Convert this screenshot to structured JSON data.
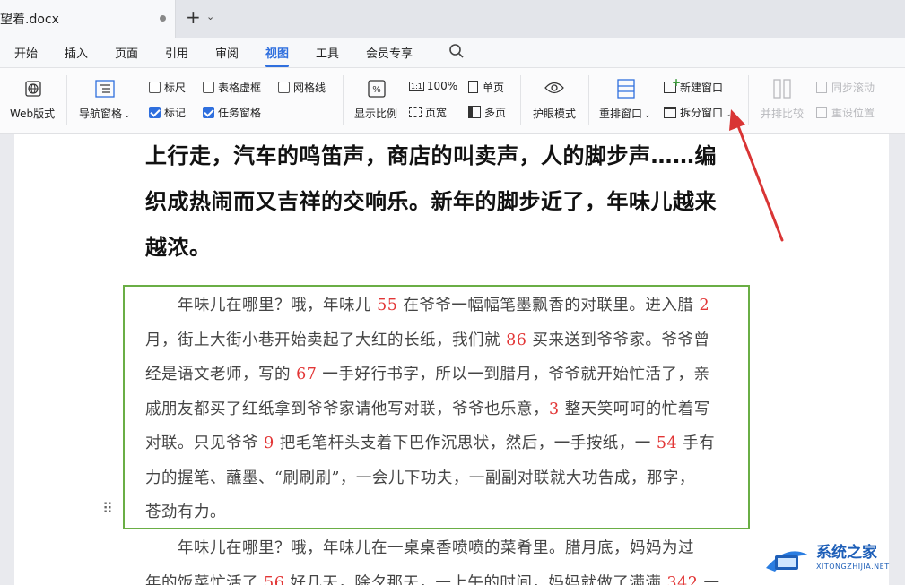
{
  "tab": {
    "title": "望着.docx",
    "new_tab_label": "+",
    "new_tab_dropdown": "⌄"
  },
  "menu": {
    "items": [
      "开始",
      "插入",
      "页面",
      "引用",
      "审阅",
      "视图",
      "工具",
      "会员专享"
    ],
    "active": "视图",
    "search_icon": "search-icon"
  },
  "ribbon": {
    "web_layout": "Web版式",
    "nav_pane": "导航窗格",
    "ruler": "标尺",
    "table_gridlines": "表格虚框",
    "gridlines": "网格线",
    "markers": "标记",
    "task_pane": "任务窗格",
    "zoom": "显示比例",
    "zoom_100": "100%",
    "page_width": "页宽",
    "single_page": "单页",
    "multi_page": "多页",
    "eye_mode": "护眼模式",
    "arrange": "重排窗口",
    "new_window": "新建窗口",
    "split_window": "拆分窗口",
    "side_by_side": "并排比较",
    "sync_scroll": "同步滚动",
    "reset_position": "重设位置",
    "checkboxes": {
      "ruler": false,
      "table_gridlines": false,
      "gridlines": false,
      "markers": true,
      "task_pane": true
    }
  },
  "document": {
    "heading_lines": [
      "上行走，汽车的鸣笛声，商店的叫卖声，人的脚步声……编",
      "织成热闹而又吉祥的交响乐。新年的脚步近了，年味儿越来",
      "越浓。"
    ],
    "para1": [
      [
        "　　年味儿在哪里？哦，年味儿 ",
        "55",
        " 在爷爷一幅幅笔墨飘香的对联里。进入腊 ",
        "2"
      ],
      [
        "月，街上大街小巷开始卖起了大红的长纸，我们就 ",
        "86",
        " 买来送到爷爷家。爷爷曾"
      ],
      [
        "经是语文老师，写的 ",
        "67",
        " 一手好行书字，所以一到腊月，爷爷就开始忙活了，亲"
      ],
      [
        "戚朋友都买了红纸拿到爷爷家请他写对联，爷爷也乐意，",
        "3",
        " 整天笑呵呵的忙着写"
      ],
      [
        "对联。只见爷爷 ",
        "9",
        " 把毛笔杆头支着下巴作沉思状，然后，一手按纸，一 ",
        "54",
        " 手有"
      ],
      [
        "力的握笔、蘸墨、“刷刷刷”，一会儿下功夫，一副副对联就大功告成，那字，"
      ],
      [
        "苍劲有力。"
      ]
    ],
    "para2": [
      [
        "　　年味儿在哪里？哦，年味儿在一桌桌香喷喷的菜肴里。腊月底，妈妈为过"
      ],
      [
        "年的饭菜忙活了 ",
        "56",
        " 好几天，除夕那天，一上午的时间，妈妈就做了满满 ",
        "342",
        " 一"
      ]
    ]
  },
  "watermark": {
    "title": "系统之家",
    "subtitle": "XITONGZHIJIA.NET"
  },
  "colors": {
    "accent": "#2f6fde",
    "frame": "#6aae45",
    "number": "#e23636",
    "arrow": "#d93535"
  }
}
